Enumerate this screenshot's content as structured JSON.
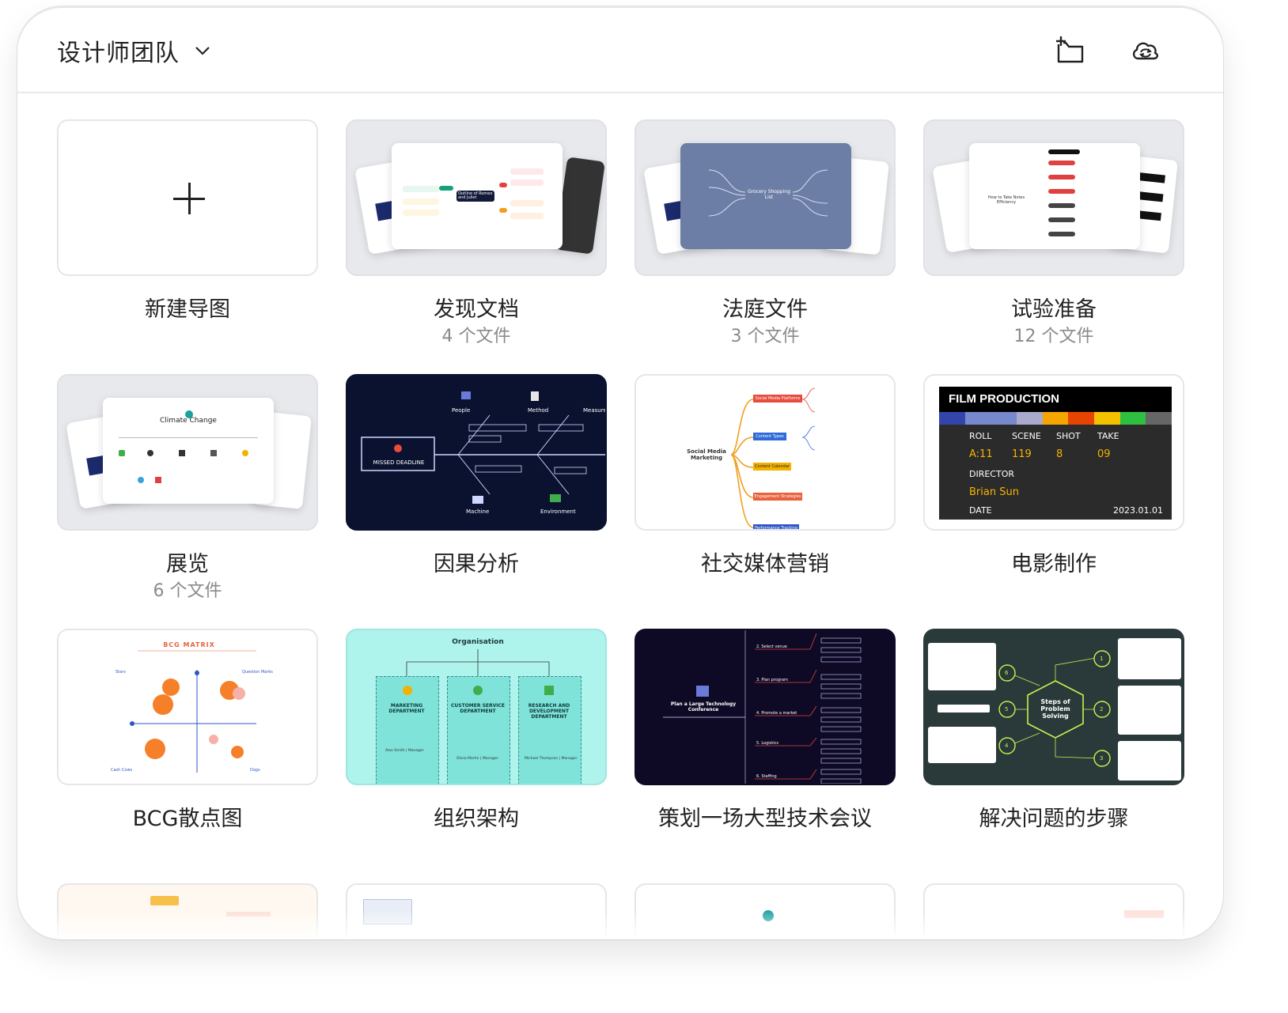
{
  "header": {
    "team_name": "设计师团队"
  },
  "tiles": [
    {
      "title": "新建导图",
      "sub": ""
    },
    {
      "title": "发现文档",
      "sub": "4 个文件"
    },
    {
      "title": "法庭文件",
      "sub": "3 个文件"
    },
    {
      "title": "试验准备",
      "sub": "12 个文件"
    },
    {
      "title": "展览",
      "sub": "6 个文件"
    },
    {
      "title": "因果分析",
      "sub": ""
    },
    {
      "title": "社交媒体营销",
      "sub": ""
    },
    {
      "title": "电影制作",
      "sub": ""
    },
    {
      "title": "BCG散点图",
      "sub": ""
    },
    {
      "title": "组织架构",
      "sub": ""
    },
    {
      "title": "策划一场大型技术会议",
      "sub": ""
    },
    {
      "title": "解决问题的步骤",
      "sub": ""
    }
  ],
  "thumbs": {
    "discover": {
      "center": "Outline of Romeo and Juliet"
    },
    "court": {
      "center": "Grocery Shopping List"
    },
    "trial": {
      "center": "How to Take Notes Efficiency"
    },
    "expo": {
      "title": "Climate Change"
    },
    "cause": {
      "center": "MISSED DEADLINE",
      "b1": "People",
      "b2": "Method",
      "b3": "Measurement",
      "b4": "Machine",
      "b5": "Environment"
    },
    "social": {
      "center": "Social Media Marketing",
      "n1": "Social Media Platforms",
      "n2": "Content Types",
      "n3": "Content Calendar",
      "n4": "Engagement Strategies",
      "n5": "Performance Tracking"
    },
    "film": {
      "title": "FILM PRODUCTION",
      "roll_h": "ROLL",
      "scene_h": "SCENE",
      "shot_h": "SHOT",
      "take_h": "TAKE",
      "roll": "A:11",
      "scene": "119",
      "shot": "8",
      "take": "09",
      "director_h": "DIRECTOR",
      "director": "Brian Sun",
      "date_h": "DATE",
      "date": "2023.01.01"
    },
    "bcg": {
      "title": "BCG MATRIX",
      "q1": "Stars",
      "q2": "Question Marks",
      "q3": "Cash Cows",
      "q4": "Dogs"
    },
    "org": {
      "title": "Organisation",
      "d1": "MARKETING DEPARTMENT",
      "d2": "CUSTOMER SERVICE DEPARTMENT",
      "d3": "RESEARCH AND DEVELOPMENT DEPARTMENT",
      "p1": "Alan Smith | Manager",
      "p2": "Olivia Martin | Manager",
      "p3": "Michael Thompson | Manager"
    },
    "conf": {
      "center": "Plan a Large Technology Conference",
      "s1": "2. Select venue",
      "s2": "3. Plan program",
      "s3": "4. Promote a market",
      "s4": "5. Logistics",
      "s5": "6. Staffing"
    },
    "steps": {
      "center": "Steps of Problem Solving",
      "n1": "1",
      "n2": "2",
      "n3": "3",
      "n4": "4",
      "n5": "5",
      "n6": "6"
    }
  },
  "colors": {
    "accent": "#2f6bd8",
    "dark_navy": "#0b1230",
    "teal": "#aef3ec",
    "film_bg": "#2b2b2b"
  }
}
